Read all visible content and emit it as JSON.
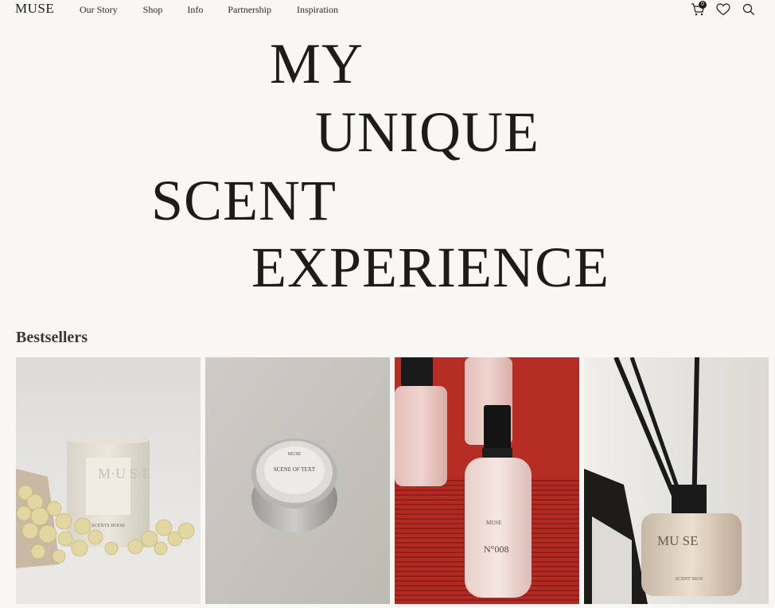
{
  "header": {
    "logo": "MUSE",
    "nav": [
      "Our Story",
      "Shop",
      "Info",
      "Partnership",
      "Inspiration"
    ],
    "cart_count": "0",
    "icons": [
      "cart-icon",
      "heart-icon",
      "search-icon"
    ]
  },
  "hero": {
    "lines": [
      "MY",
      "UNIQUE",
      "SCENT",
      "EXPERIENCE"
    ]
  },
  "bestsellers": {
    "title": "Bestsellers",
    "products": [
      {
        "image": "candle-with-popcorn",
        "label_text": "M·U S·E",
        "label_sub": "SCENTS HOOD"
      },
      {
        "image": "tin-candle",
        "label_text": "MUSE",
        "label_sub": "SCENE OF TEXT"
      },
      {
        "image": "room-spray-bottles",
        "label_text": "MUSE",
        "label_sub": "N°008"
      },
      {
        "image": "reed-diffuser",
        "label_text": "MU SE",
        "label_sub": "SCENT SIGN"
      }
    ]
  },
  "colors": {
    "background": "#f8f7f3",
    "text": "#1d1c1a",
    "red_backdrop": "#b32a22"
  }
}
